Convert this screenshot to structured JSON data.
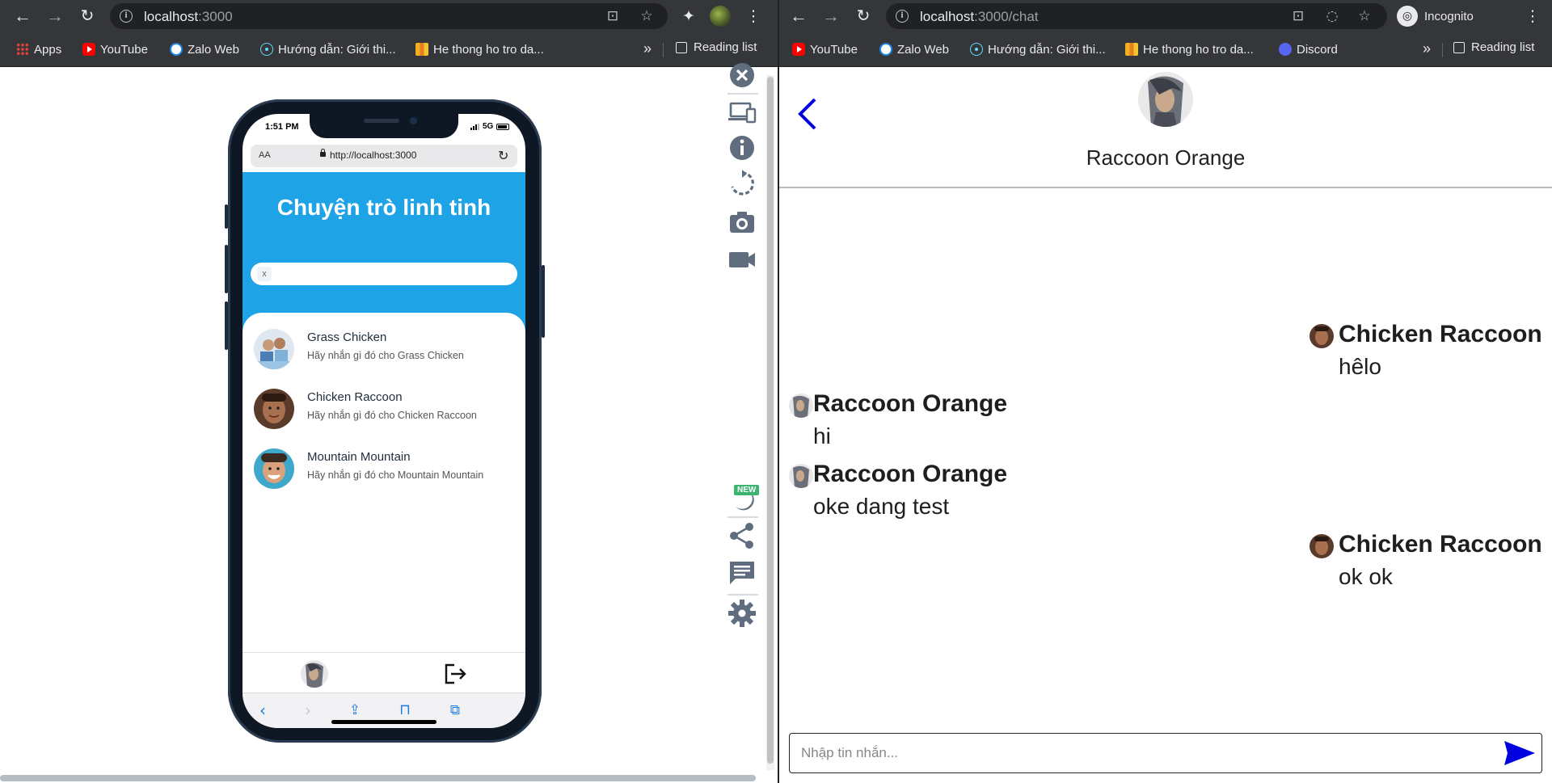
{
  "left_window": {
    "url_host": "localhost",
    "url_path": ":3000",
    "bookmarks": [
      {
        "label": "Apps",
        "icon": "apps-grid-icon"
      },
      {
        "label": "YouTube",
        "icon": "youtube-icon"
      },
      {
        "label": "Zalo Web",
        "icon": "zalo-icon"
      },
      {
        "label": "Hướng dẫn: Giới thi...",
        "icon": "react-icon"
      },
      {
        "label": "He thong ho tro da...",
        "icon": "ht-icon"
      }
    ],
    "more": "»",
    "reading_list": "Reading list",
    "phone": {
      "status_time": "1:51 PM",
      "network": "5G",
      "safari_aa": "AA",
      "safari_url": "http://localhost:3000",
      "app_title": "Chuyện trò linh tinh",
      "search_clear": "x",
      "contacts": [
        {
          "name": "Grass Chicken",
          "subtitle": "Hãy nhắn gì đó cho Grass Chicken"
        },
        {
          "name": "Chicken Raccoon",
          "subtitle": "Hãy nhắn gì đó cho Chicken Raccoon"
        },
        {
          "name": "Mountain Mountain",
          "subtitle": "Hãy nhắn gì đó cho Mountain Mountain"
        }
      ]
    },
    "devtools_badge": "NEW"
  },
  "right_window": {
    "url_host": "localhost",
    "url_path": ":3000/chat",
    "incognito": "Incognito",
    "bookmarks": [
      {
        "label": "YouTube",
        "icon": "youtube-icon"
      },
      {
        "label": "Zalo Web",
        "icon": "zalo-icon"
      },
      {
        "label": "Hướng dẫn: Giới thi...",
        "icon": "react-icon"
      },
      {
        "label": "He thong ho tro da...",
        "icon": "ht-icon"
      },
      {
        "label": "Discord",
        "icon": "discord-icon"
      }
    ],
    "more": "»",
    "reading_list": "Reading list",
    "chat": {
      "partner_name": "Raccoon Orange",
      "messages": [
        {
          "sender": "Chicken Raccoon",
          "text": "hêlo",
          "side": "right"
        },
        {
          "sender": "Raccoon Orange",
          "text": "hi",
          "side": "left"
        },
        {
          "sender": "Raccoon Orange",
          "text": "oke dang test",
          "side": "left"
        },
        {
          "sender": "Chicken Raccoon",
          "text": "ok ok",
          "side": "right"
        }
      ],
      "input_placeholder": "Nhập tin nhắn..."
    }
  },
  "colors": {
    "chrome_dark": "#35363a",
    "app_header_blue": "#1ea3e6",
    "send_blue": "#0000e0"
  }
}
